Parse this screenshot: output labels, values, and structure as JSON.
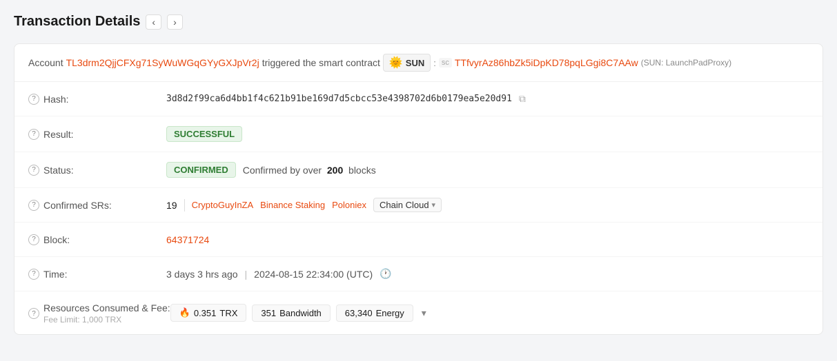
{
  "page": {
    "title": "Transaction Details",
    "nav_prev": "‹",
    "nav_next": "›"
  },
  "account_row": {
    "prefix": "Account",
    "account_address": "TL3drm2QjjCFXg71SyWuWGqGYyGXJpVr2j",
    "trigger_text": "triggered the smart contract",
    "sun_badge": {
      "emoji": "🌞",
      "label": "SUN"
    },
    "colon": ":",
    "sc_label": "sc",
    "contract_address": "TTfvyrAz86hbZk5iDpKD78pqLGgi8C7AAw",
    "contract_note": "(SUN: LaunchPadProxy)"
  },
  "fields": {
    "hash": {
      "label": "Hash:",
      "value": "3d8d2f99ca6d4bb1f4c621b91be169d7d5cbcc53e4398702d6b0179ea5e20d91",
      "copy_icon": "⧉"
    },
    "result": {
      "label": "Result:",
      "value": "SUCCESSFUL"
    },
    "status": {
      "label": "Status:",
      "badge": "CONFIRMED",
      "confirmed_text": "Confirmed by over",
      "blocks_count": "200",
      "blocks_text": "blocks"
    },
    "confirmed_srs": {
      "label": "Confirmed SRs:",
      "count": "19",
      "items": [
        "CryptoGuyInZA",
        "Binance Staking",
        "Poloniex",
        "Chain Cloud"
      ],
      "expand_label": "▾"
    },
    "block": {
      "label": "Block:",
      "value": "64371724"
    },
    "time": {
      "label": "Time:",
      "relative": "3 days 3 hrs ago",
      "divider": "|",
      "utc": "2024-08-15 22:34:00 (UTC)",
      "clock_icon": "🕐"
    },
    "resources": {
      "label": "Resources Consumed & Fee:",
      "fee_limit_note": "Fee Limit: 1,000 TRX",
      "trx_amount": "0.351",
      "trx_label": "TRX",
      "bandwidth_amount": "351",
      "bandwidth_label": "Bandwidth",
      "energy_amount": "63,340",
      "energy_label": "Energy",
      "expand_icon": "▾"
    }
  }
}
